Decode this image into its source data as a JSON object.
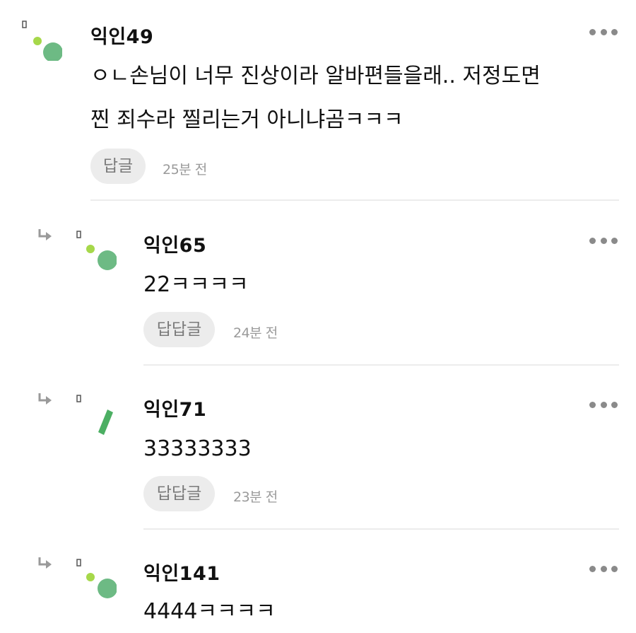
{
  "comments": [
    {
      "author": "익인49",
      "text_lines": [
        "ㅇㄴ손님이 너무 진상이라 알바편들을래.. 저정도면",
        "찐 죄수라 찔리는거 아니냐곰ㅋㅋㅋ"
      ],
      "reply_label": "답글",
      "time": "25분 전"
    },
    {
      "author": "익인65",
      "text_lines": [
        "22ㅋㅋㅋㅋ"
      ],
      "reply_label": "답답글",
      "time": "24분 전"
    },
    {
      "author": "익인71",
      "text_lines": [
        "33333333"
      ],
      "reply_label": "답답글",
      "time": "23분 전"
    },
    {
      "author": "익인141",
      "text_lines": [
        "4444ㅋㅋㅋㅋ"
      ]
    }
  ],
  "colors": {
    "avatar_green": "#6dba84",
    "avatar_dot": "#a6d84a",
    "icon_gray": "#8a8a8a",
    "reply_bg": "#ececec"
  }
}
